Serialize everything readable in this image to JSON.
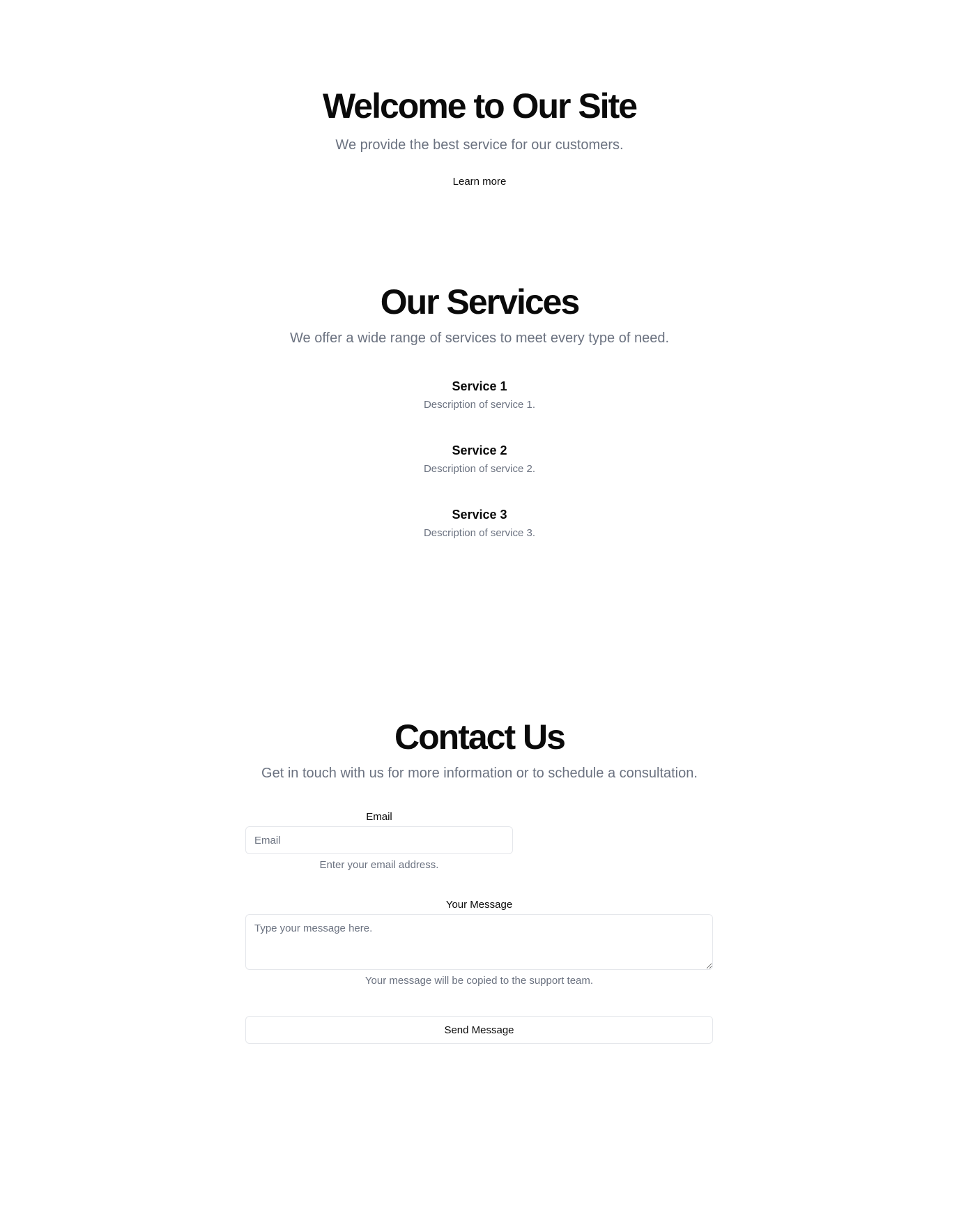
{
  "hero": {
    "title": "Welcome to Our Site",
    "subtitle": "We provide the best service for our customers.",
    "cta_label": "Learn more"
  },
  "services": {
    "title": "Our Services",
    "subtitle": "We offer a wide range of services to meet every type of need.",
    "items": [
      {
        "title": "Service 1",
        "description": "Description of service 1."
      },
      {
        "title": "Service 2",
        "description": "Description of service 2."
      },
      {
        "title": "Service 3",
        "description": "Description of service 3."
      }
    ]
  },
  "contact": {
    "title": "Contact Us",
    "subtitle": "Get in touch with us for more information or to schedule a consultation.",
    "email": {
      "label": "Email",
      "placeholder": "Email",
      "value": "",
      "hint": "Enter your email address."
    },
    "message": {
      "label": "Your Message",
      "placeholder": "Type your message here.",
      "value": "",
      "hint": "Your message will be copied to the support team."
    },
    "submit_label": "Send Message"
  }
}
